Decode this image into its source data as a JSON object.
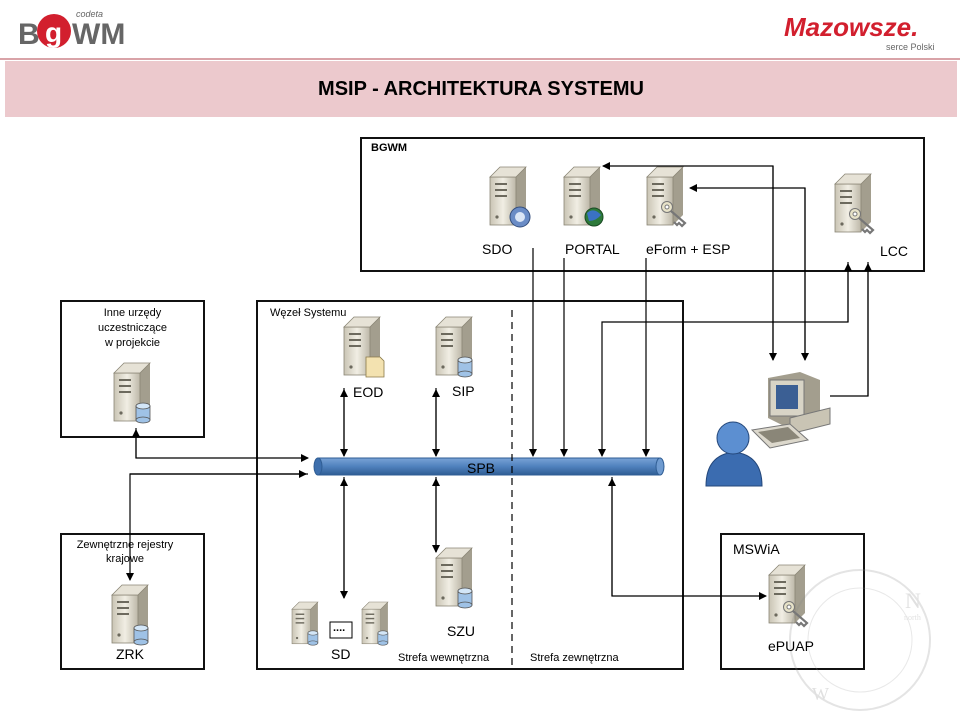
{
  "header": {
    "left_logo": {
      "text": "BGWM",
      "subtext": "codeta"
    },
    "right_logo": {
      "text": "Mazowsze.",
      "tagline": "serce Polski"
    },
    "title": "MSIP - ARCHITEKTURA SYSTEMU"
  },
  "bgwm": {
    "label": "BGWM",
    "servers": {
      "sdo": "SDO",
      "portal": "PORTAL",
      "eform": "eForm + ESP",
      "lcc": "LCC"
    }
  },
  "inne": {
    "line1": "Inne urzędy",
    "line2": "uczestniczące",
    "line3": "w projekcie"
  },
  "wezel": {
    "label": "Węzeł Systemu",
    "eod": "EOD",
    "sip": "SIP",
    "spb": "SPB",
    "szu": "SZU",
    "sd": "SD",
    "dots": "....",
    "strefa_wew": "Strefa wewnętrzna",
    "strefa_zew": "Strefa zewnętrzna"
  },
  "zewnetrzne": {
    "line1": "Zewnętrzne rejestry",
    "line2": "krajowe",
    "zrk": "ZRK"
  },
  "mswia": {
    "label": "MSWiA",
    "epuap": "ePUAP"
  },
  "icons": [
    "server-icon",
    "server-db-icon",
    "server-globe-icon",
    "server-key-icon",
    "server-doc-icon",
    "workstation-icon",
    "user-icon",
    "compass-icon"
  ],
  "colors": {
    "title_band": "#ecc9cd",
    "spb_bus": "#4f81bd",
    "line": "#000000"
  }
}
